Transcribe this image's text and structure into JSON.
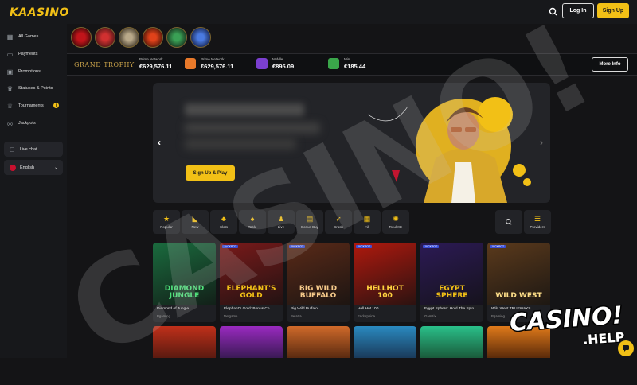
{
  "header": {
    "logo": "KAASINO",
    "login_label": "Log In",
    "signup_label": "Sign Up"
  },
  "sidebar": {
    "items": [
      {
        "label": "All Games",
        "icon": "grid-icon"
      },
      {
        "label": "Payments",
        "icon": "wallet-icon"
      },
      {
        "label": "Promotions",
        "icon": "gift-icon"
      },
      {
        "label": "Statuses & Points",
        "icon": "crown-icon"
      },
      {
        "label": "Tournaments",
        "icon": "trophy-icon",
        "badge": "i"
      },
      {
        "label": "Jackpots",
        "icon": "coins-icon"
      }
    ],
    "live_chat": "Live chat",
    "language": "English"
  },
  "trophy": {
    "title": "GRAND TROPHY",
    "jackpots": [
      {
        "caption": "Prime Network",
        "amount": "€629,576.11"
      },
      {
        "caption": "Prime Network",
        "amount": "€629,576.11"
      },
      {
        "caption": "Middle",
        "amount": "€895.09"
      },
      {
        "caption": "Mini",
        "amount": "€185.44"
      }
    ],
    "more_info": "More Info"
  },
  "hero": {
    "cta": "Sign Up & Play"
  },
  "categories": [
    {
      "label": "Popular",
      "icon": "star-icon"
    },
    {
      "label": "New",
      "icon": "new-icon"
    },
    {
      "label": "Slots",
      "icon": "cherry-icon"
    },
    {
      "label": "Table",
      "icon": "spade-icon"
    },
    {
      "label": "Live",
      "icon": "dealer-icon"
    },
    {
      "label": "Bonus Buy",
      "icon": "bonus-icon"
    },
    {
      "label": "Crash",
      "icon": "rocket-icon"
    },
    {
      "label": "All",
      "icon": "grid-icon"
    },
    {
      "label": "Roulette",
      "icon": "roulette-icon"
    }
  ],
  "providers_label": "Providers",
  "games": [
    {
      "name": "Diamond of Jungle",
      "provider": "Bgaming",
      "thumb_text": "DIAMOND\nJUNGLE",
      "bg": "#1a6b3e",
      "fg": "#4fe07a"
    },
    {
      "name": "Elephant's Gold: Bonus Co...",
      "provider": "Netgame",
      "thumb_text": "ELEPHANT'S\nGOLD",
      "bg": "#7a1a1a",
      "fg": "#f2c016"
    },
    {
      "name": "Big Wild Buffalo",
      "provider": "Belatra",
      "thumb_text": "BIG WILD\nBUFFALO",
      "bg": "#5a2a18",
      "fg": "#f5c98a"
    },
    {
      "name": "Hell Hot 100",
      "provider": "Endorphina",
      "thumb_text": "HELLHOT\n100",
      "bg": "#b0190e",
      "fg": "#ffd23f"
    },
    {
      "name": "Egypt Sphere: Hold The Spin",
      "provider": "Gamzix",
      "thumb_text": "EGYPT\nSPHERE",
      "bg": "#2c1a55",
      "fg": "#f2c016"
    },
    {
      "name": "Wild West TRUEWAYS",
      "provider": "Bgaming",
      "thumb_text": "WILD WEST",
      "bg": "#5b3a1c",
      "fg": "#ffe08a"
    }
  ],
  "game_tag": "JACKPOT",
  "watermark": "CASINO!",
  "brand": {
    "main": "CASINO!",
    "sub": ".HELP"
  }
}
